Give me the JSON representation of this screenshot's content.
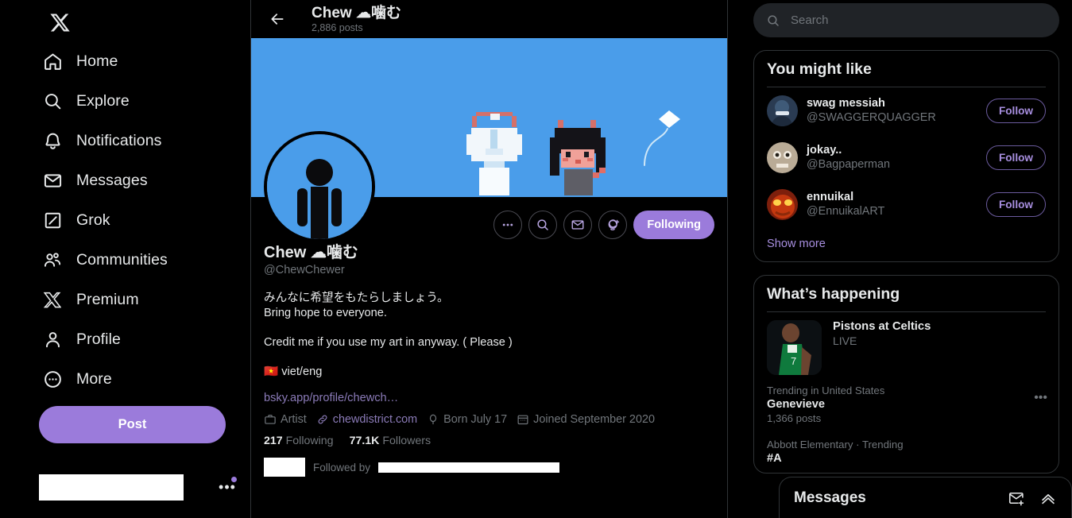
{
  "sidebar": {
    "logo_icon": "x-logo-icon",
    "items": [
      {
        "label": "Home",
        "icon": "home-icon"
      },
      {
        "label": "Explore",
        "icon": "search-icon"
      },
      {
        "label": "Notifications",
        "icon": "bell-icon"
      },
      {
        "label": "Messages",
        "icon": "envelope-icon"
      },
      {
        "label": "Grok",
        "icon": "grok-icon"
      },
      {
        "label": "Communities",
        "icon": "communities-icon"
      },
      {
        "label": "Premium",
        "icon": "x-logo-icon"
      },
      {
        "label": "Profile",
        "icon": "person-icon"
      },
      {
        "label": "More",
        "icon": "more-circle-icon"
      }
    ],
    "post_label": "Post"
  },
  "topbar": {
    "back_icon": "arrow-left-icon",
    "title": "Chew ☁噛む",
    "posts_count": "2,886 posts"
  },
  "profile": {
    "banner_color": "#4a9dea",
    "actions": [
      {
        "name": "more-options-button",
        "icon": "ellipsis-icon"
      },
      {
        "name": "search-profile-button",
        "icon": "search-icon"
      },
      {
        "name": "message-button",
        "icon": "envelope-icon"
      },
      {
        "name": "notify-button",
        "icon": "bell-plus-icon"
      }
    ],
    "following_label": "Following",
    "following_color": "#9b7bdb",
    "display_name": "Chew ☁噛む",
    "handle": "@ChewChewer",
    "bio": "みんなに希望をもたらしましょう。\nBring hope to everyone.\n\nCredit me if you use my art in anyway. ( Please )\n\n🇻🇳 viet/eng",
    "bio_link": "bsky.app/profile/chewch…",
    "meta": {
      "occupation": "Artist",
      "occupation_icon": "briefcase-icon",
      "website": "chewdistrict.com",
      "website_icon": "link-icon",
      "birthday": "Born July 17",
      "birthday_icon": "balloon-icon",
      "joined": "Joined September 2020",
      "joined_icon": "calendar-icon"
    },
    "following_count": "217",
    "following_text": "Following",
    "followers_count": "77.1K",
    "followers_text": "Followers",
    "followed_by_label": "Followed by"
  },
  "search": {
    "placeholder": "Search",
    "icon": "search-icon"
  },
  "you_might_like": {
    "title": "You might like",
    "accounts": [
      {
        "name": "swag messiah",
        "handle": "@SWAGGERQUAGGER",
        "follow_label": "Follow"
      },
      {
        "name": "jokay..",
        "handle": "@Bagpaperman",
        "follow_label": "Follow"
      },
      {
        "name": "ennuikal",
        "handle": "@EnnuikalART",
        "follow_label": "Follow"
      }
    ],
    "show_more": "Show more"
  },
  "whats_happening": {
    "title": "What’s happening",
    "live_event": {
      "title": "Pistons at Celtics",
      "status": "LIVE"
    },
    "trends": [
      {
        "category": "Trending in United States",
        "name": "Genevieve",
        "count": "1,366 posts"
      },
      {
        "category": "Abbott Elementary · Trending",
        "name": "#A",
        "count": ""
      }
    ]
  },
  "messages_dock": {
    "title": "Messages",
    "new_message_icon": "envelope-plus-icon",
    "expand_icon": "chevron-up-icon"
  }
}
